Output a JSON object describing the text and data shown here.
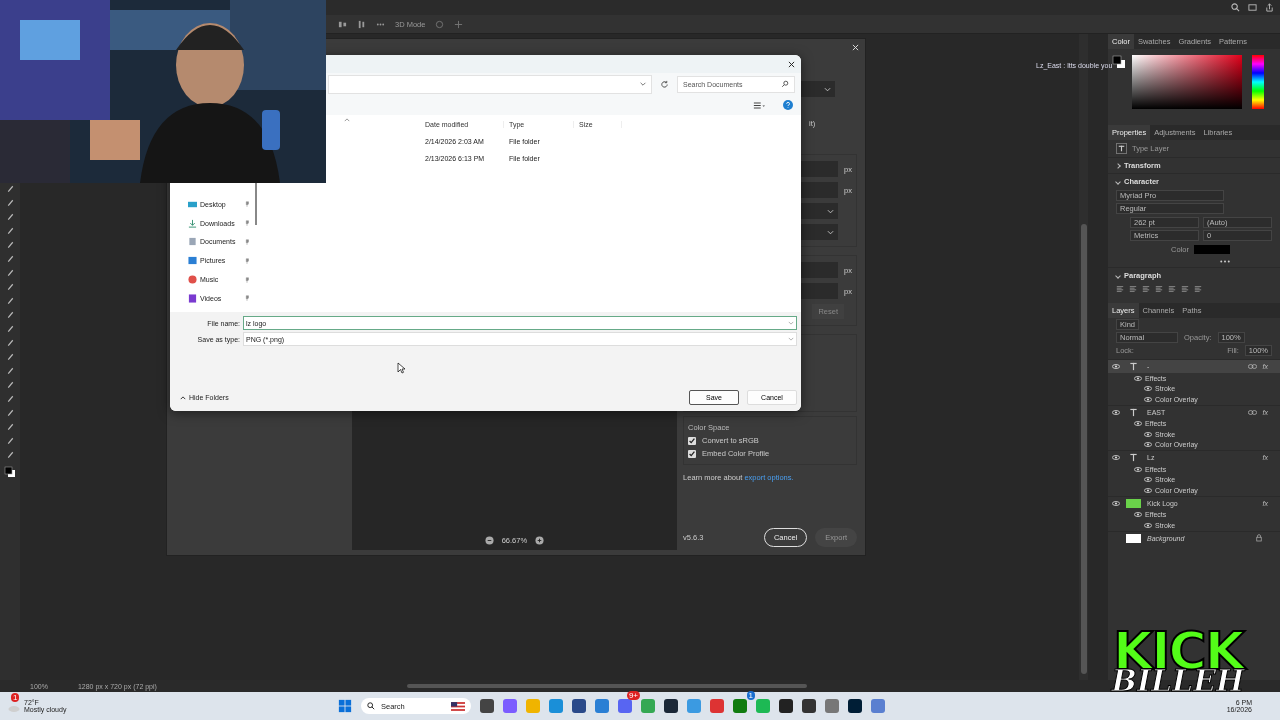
{
  "app": {
    "mode_label": "3D Mode",
    "canvas_caption": "Lz_East : ltts double you",
    "status": {
      "zoom": "100%",
      "size": "1280 px x 720 px (72 ppi)"
    }
  },
  "export_dialog": {
    "partial_label": "it)",
    "units": [
      "px",
      "px",
      "px",
      "px"
    ],
    "reset": {
      "label": "Reset",
      "disabled": true
    },
    "zoom": "66.67%",
    "color_space": {
      "title": "Color Space",
      "options": [
        {
          "label": "Convert to sRGB",
          "checked": true
        },
        {
          "label": "Embed Color Profile",
          "checked": true
        }
      ]
    },
    "learn_more": "Learn more about",
    "link": "export options.",
    "version": "v5.6.3",
    "buttons": [
      {
        "label": "Cancel",
        "disabled": false
      },
      {
        "label": "Export",
        "disabled": true
      }
    ]
  },
  "save_dialog": {
    "search": {
      "placeholder": "Search Documents"
    },
    "columns": [
      "Date modified",
      "Type",
      "Size"
    ],
    "rows": [
      {
        "date": "2/14/2026 2:03 AM",
        "type": "File folder"
      },
      {
        "date": "2/13/2026 6:13 PM",
        "type": "File folder"
      }
    ],
    "nav": [
      {
        "label": "Desktop",
        "kind": "desktop"
      },
      {
        "label": "Downloads",
        "kind": "downloads"
      },
      {
        "label": "Documents",
        "kind": "documents"
      },
      {
        "label": "Pictures",
        "kind": "pictures"
      },
      {
        "label": "Music",
        "kind": "music"
      },
      {
        "label": "Videos",
        "kind": "videos"
      }
    ],
    "file_name_label": "File name:",
    "file_name": "lz logo",
    "type_label": "Save as type:",
    "type_value": "PNG (*.png)",
    "hide_folders": "Hide Folders",
    "buttons": [
      "Save",
      "Cancel"
    ]
  },
  "panels": {
    "color_tabs": [
      {
        "label": "Color",
        "selected": true
      },
      {
        "label": "Swatches",
        "selected": false
      },
      {
        "label": "Gradients",
        "selected": false
      },
      {
        "label": "Patterns",
        "selected": false
      }
    ],
    "properties_tabs": [
      {
        "label": "Properties",
        "selected": true
      },
      {
        "label": "Adjustments",
        "selected": false
      },
      {
        "label": "Libraries",
        "selected": false
      }
    ],
    "layer_kind": "Type Layer",
    "transform": {
      "title": "Transform",
      "expanded": false
    },
    "character": {
      "title": "Character",
      "expanded": true,
      "font": "Myriad Pro",
      "style": "Regular",
      "size": "262 pt",
      "leading": "(Auto)",
      "kerning": "Metrics",
      "tracking": "0",
      "color_label": "Color"
    },
    "paragraph": {
      "title": "Paragraph",
      "expanded": true
    },
    "layers_tabs": [
      {
        "label": "Layers",
        "selected": true
      },
      {
        "label": "Channels",
        "selected": false
      },
      {
        "label": "Paths",
        "selected": false
      }
    ],
    "filter": "Kind",
    "blend": "Normal",
    "opacity_label": "Opacity:",
    "opacity": "100%",
    "lock_label": "Lock:",
    "fill_label": "Fill:",
    "fill": "100%",
    "layers": [
      {
        "name": "-",
        "kind": "text",
        "visible": true,
        "selected": true,
        "linked": true,
        "fx": "fx",
        "effects_title": "Effects",
        "effects": [
          "Stroke",
          "Color Overlay"
        ]
      },
      {
        "name": "EAST",
        "kind": "text",
        "visible": true,
        "selected": false,
        "linked": true,
        "fx": "fx",
        "effects_title": "Effects",
        "effects": [
          "Stroke",
          "Color Overlay"
        ]
      },
      {
        "name": "Lz",
        "kind": "text",
        "visible": true,
        "selected": false,
        "linked": false,
        "fx": "fx",
        "effects_title": "Effects",
        "effects": [
          "Stroke",
          "Color Overlay"
        ]
      },
      {
        "name": "Kick Logo",
        "visible": true,
        "selected": false,
        "linked": false,
        "fx": "fx",
        "effects_title": "Effects",
        "effects": [
          "Stroke"
        ]
      },
      {
        "name": "Background",
        "kind": "background",
        "visible": false,
        "selected": false,
        "linked": false
      }
    ]
  },
  "taskbar": {
    "weather_badge": "1",
    "temp": "72°F",
    "condition": "Mostly cloudy",
    "search": "Search",
    "chat_app_badge": "9+",
    "game_app_badge": "1",
    "time": "6 PM",
    "date": "16/2026"
  },
  "logo": {
    "top": "KICK",
    "bottom": "BILLEH"
  }
}
